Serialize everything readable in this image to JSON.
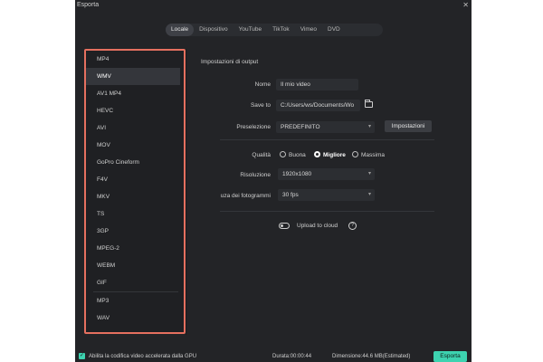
{
  "window": {
    "title": "Esporta",
    "close_glyph": "✕"
  },
  "tabs": [
    {
      "label": "Locale",
      "active": true
    },
    {
      "label": "Dispositivo",
      "active": false
    },
    {
      "label": "YouTube",
      "active": false
    },
    {
      "label": "TikTok",
      "active": false
    },
    {
      "label": "Vimeo",
      "active": false
    },
    {
      "label": "DVD",
      "active": false
    }
  ],
  "formats": {
    "video": [
      "MP4",
      "WMV",
      "AV1 MP4",
      "HEVC",
      "AVI",
      "MOV",
      "GoPro Cineform",
      "F4V",
      "MKV",
      "TS",
      "3GP",
      "MPEG-2",
      "WEBM",
      "GIF"
    ],
    "audio": [
      "MP3",
      "WAV"
    ],
    "selected": "WMV"
  },
  "output": {
    "section_title": "Impostazioni di output",
    "name_label": "Nome",
    "name_value": "Il mio video",
    "save_label": "Save to",
    "save_value": "C:/Users/ws/Documents/Wo",
    "preset_label": "Preselezione",
    "preset_value": "PREDEFINITO",
    "settings_button": "Impostazioni",
    "quality_label": "Qualità",
    "quality_options": [
      "Buona",
      "Migliore",
      "Massima"
    ],
    "quality_selected": "Migliore",
    "resolution_label": "Risoluzione",
    "resolution_value": "1920x1080",
    "framerate_label": "uza dei fotogrammi",
    "framerate_value": "30 fps",
    "cloud_label": "Upload to cloud",
    "help_glyph": "?"
  },
  "footer": {
    "gpu_label": "Abilita la codifica video accelerata dalla GPU",
    "duration": "Durata:00:00:44",
    "size": "Dimensione:44.6 MB(Estimated)",
    "export_button": "Esporta"
  },
  "icons": {
    "close": "close-icon",
    "folder": "folder-icon",
    "dropdown": "chevron-down-icon",
    "help": "help-icon",
    "checkbox": "checkbox-icon"
  },
  "colors": {
    "accent": "#3dd3b0",
    "highlight_border": "#e5705f",
    "background": "#232427"
  }
}
